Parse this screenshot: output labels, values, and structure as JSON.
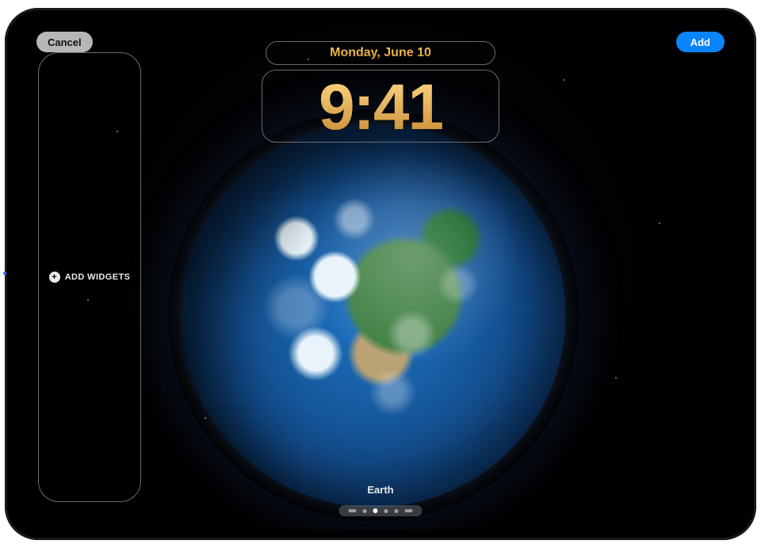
{
  "header": {
    "cancel_label": "Cancel",
    "add_label": "Add"
  },
  "lock": {
    "date": "Monday, June 10",
    "time": "9:41"
  },
  "widgets": {
    "add_label": "ADD WIDGETS"
  },
  "wallpaper": {
    "name": "Earth",
    "page_count": 6,
    "active_page_index": 2
  }
}
